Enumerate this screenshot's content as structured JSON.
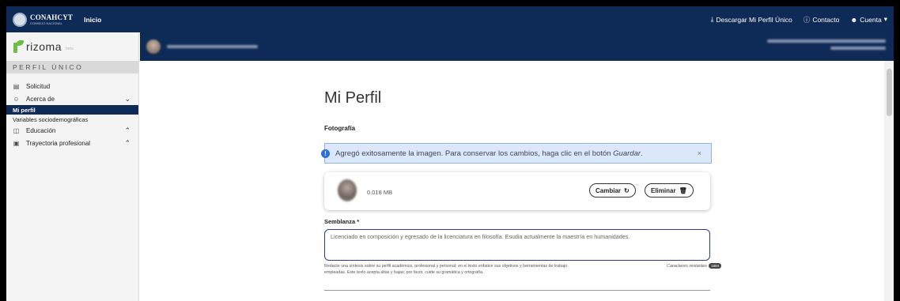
{
  "topbar": {
    "brand": "CONAHCYT",
    "brand_sub": "CONSEJO NACIONAL",
    "home_link": "Inicio",
    "download_label": "Descargar Mi Perfil Único",
    "contact_label": "Contacto",
    "account_label": "Cuenta"
  },
  "sidebar": {
    "logo_text": "rizoma",
    "logo_tag": "beta",
    "section_title": "PERFIL ÚNICO",
    "items": [
      {
        "label": "Solicitud"
      },
      {
        "label": "Acerca de"
      },
      {
        "label": "Mi perfil"
      },
      {
        "label": "Variables sociodemográficas"
      },
      {
        "label": "Educación"
      },
      {
        "label": "Trayectoria profesional"
      }
    ]
  },
  "main": {
    "title": "Mi Perfil",
    "photo_section": "Fotografía",
    "alert": {
      "text_before": "Agregó exitosamente la imagen. Para conservar los cambios, haga clic en el botón ",
      "text_emph": "Guardar",
      "text_after": ".",
      "close": "×"
    },
    "photo": {
      "size": "0.018 MB",
      "change_label": "Cambiar",
      "delete_label": "Eliminar"
    },
    "semblanza": {
      "label": "Semblanza *",
      "value": "Licenciado en composición y egresado de la licenciatura en filosofía. Esudia actualmente la maestría en humanidades.",
      "help": "Redacte una síntesis sobre su perfil académico, profesional y personal; en el texto enfatice sus objetivos y herramientas de trabajo empleadas. Este texto acepta altas y bajas; por favor, cuide su gramática y ortografía.",
      "counter_label": "Caracteres restantes",
      "counter_value": "1884"
    }
  },
  "colors": {
    "navy": "#0e2a57",
    "alert_bg": "#dbe8fb",
    "alert_border": "#8fb4ea",
    "rizoma_green": "#6dbe45"
  }
}
